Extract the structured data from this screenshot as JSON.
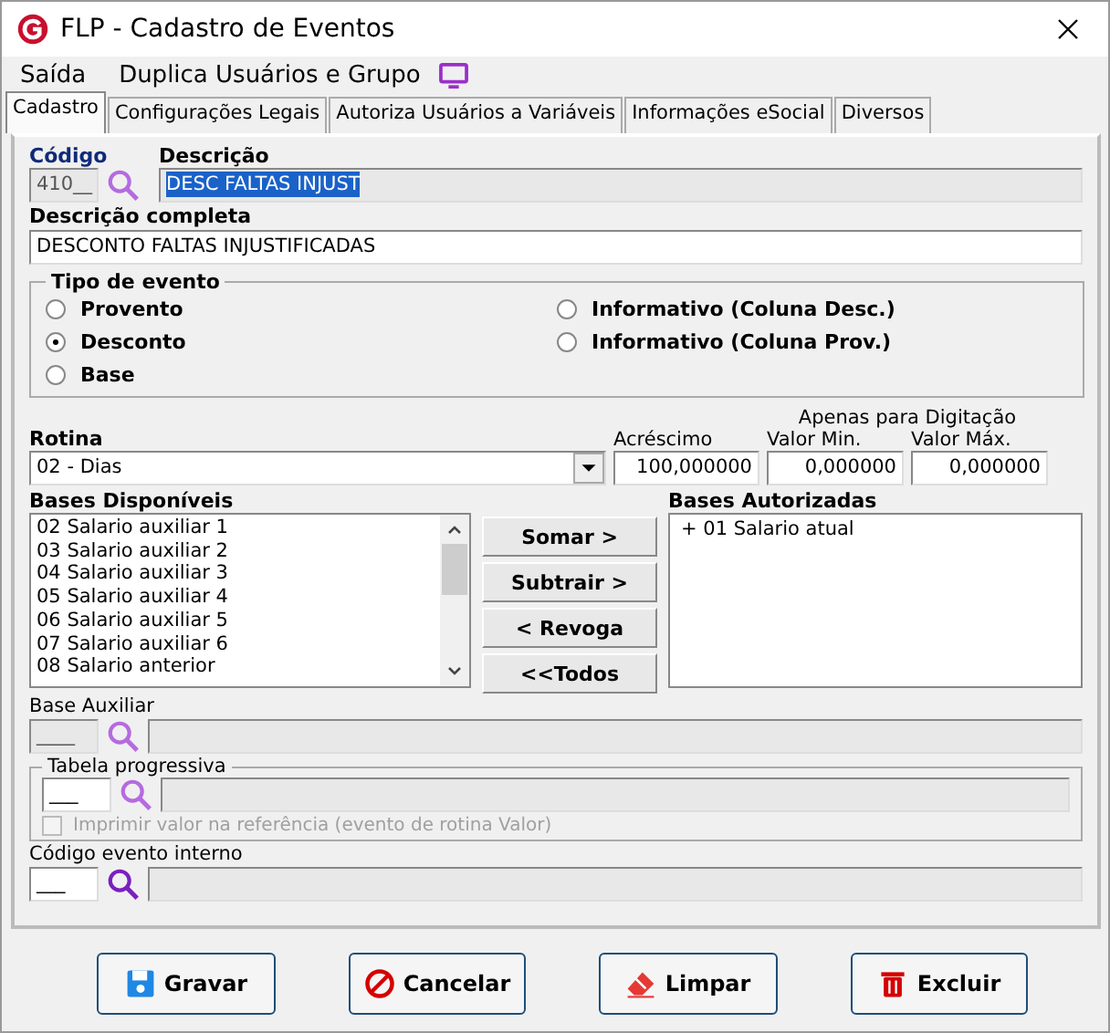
{
  "window": {
    "title": "FLP - Cadastro de Eventos"
  },
  "menu": [
    "Saída",
    "Duplica Usuários e Grupo"
  ],
  "tabs": [
    {
      "label": "Cadastro",
      "selected": true
    },
    {
      "label": "Configurações Legais",
      "selected": false
    },
    {
      "label": "Autoriza Usuários a Variáveis",
      "selected": false
    },
    {
      "label": "Informações eSocial",
      "selected": false
    },
    {
      "label": "Diversos",
      "selected": false
    }
  ],
  "codigo": {
    "label": "Código",
    "value": "410__"
  },
  "descricao": {
    "label": "Descrição",
    "value": "DESC FALTAS INJUST"
  },
  "descricao_completa": {
    "label": "Descrição completa",
    "value": "DESCONTO FALTAS INJUSTIFICADAS"
  },
  "tipo_evento": {
    "label": "Tipo de evento",
    "options": [
      {
        "label": "Provento",
        "selected": false
      },
      {
        "label": "Desconto",
        "selected": true
      },
      {
        "label": "Base",
        "selected": false
      },
      {
        "label": "Informativo (Coluna Desc.)",
        "selected": false
      },
      {
        "label": "Informativo (Coluna Prov.)",
        "selected": false
      }
    ]
  },
  "rotina": {
    "label": "Rotina",
    "value": "02 - Dias"
  },
  "digitacao_note": "Apenas para Digitação",
  "acrescimo": {
    "label": "Acréscimo",
    "value": "100,000000"
  },
  "valor_min": {
    "label": "Valor Min.",
    "value": "0,000000"
  },
  "valor_max": {
    "label": "Valor Máx.",
    "value": "0,000000"
  },
  "bases_disponiveis": {
    "label": "Bases Disponíveis",
    "items": [
      "02 Salario auxiliar 1",
      "03 Salario auxiliar 2",
      "04 Salario auxiliar 3",
      "05 Salario auxiliar 4",
      "06 Salario auxiliar 5",
      "07 Salario auxiliar 6",
      "08 Salario anterior"
    ]
  },
  "transfer_buttons": [
    "Somar >",
    "Subtrair >",
    "< Revoga",
    "<<Todos"
  ],
  "bases_autorizadas": {
    "label": "Bases Autorizadas",
    "items": [
      "+ 01 Salario atual"
    ]
  },
  "base_auxiliar": {
    "label": "Base Auxiliar",
    "value": "____"
  },
  "tabela_progressiva": {
    "label": "Tabela progressiva",
    "value": "___",
    "checkbox": {
      "label": "Imprimir valor na referência (evento de rotina Valor)",
      "checked": false,
      "disabled": true
    }
  },
  "codigo_evento_interno": {
    "label": "Código evento interno",
    "value": "___"
  },
  "actions": [
    {
      "kind": "save",
      "label": "Gravar"
    },
    {
      "kind": "cancel",
      "label": "Cancelar"
    },
    {
      "kind": "clear",
      "label": "Limpar"
    },
    {
      "kind": "delete",
      "label": "Excluir"
    }
  ]
}
